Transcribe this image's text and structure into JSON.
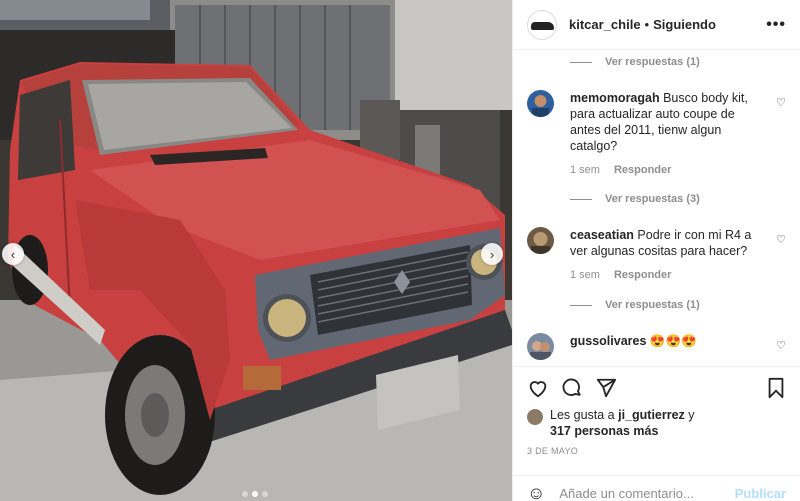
{
  "header": {
    "username": "kitcar_chile",
    "separator": "•",
    "follow_status": "Siguiendo",
    "more": "•••"
  },
  "comments": [
    {
      "username": "memomoragah",
      "text": "Busco body kit, para actualizar auto coupe de antes del 2011, tienw algun catalgo?",
      "time": "1 sem",
      "reply": "Responder"
    },
    {
      "username": "ceaseatian",
      "text": "Podre ir con mi R4 a ver algunas cositas para hacer?",
      "time": "1 sem",
      "reply": "Responder"
    },
    {
      "username": "gussolivares",
      "text": "😍😍😍"
    }
  ],
  "view_replies": [
    "Ver respuestas (1)",
    "Ver respuestas (3)",
    "Ver respuestas (1)"
  ],
  "likes": {
    "prefix": "Les gusta a ",
    "user": "ji_gutierrez",
    "middle": " y",
    "count": "317 personas más"
  },
  "date": "3 DE MAYO",
  "add_comment": {
    "placeholder": "Añade un comentario...",
    "publish": "Publicar"
  },
  "carousel": {
    "slides": 3,
    "current": 2
  },
  "icons": [
    "heart-icon",
    "comment-icon",
    "share-icon",
    "bookmark-icon",
    "smile-icon",
    "chevron-left-icon",
    "chevron-right-icon",
    "more-icon"
  ],
  "colors": {
    "link_blue_disabled": "#b2dffc",
    "meta_gray": "#8e8e8e",
    "car_red": "#c8403f"
  }
}
